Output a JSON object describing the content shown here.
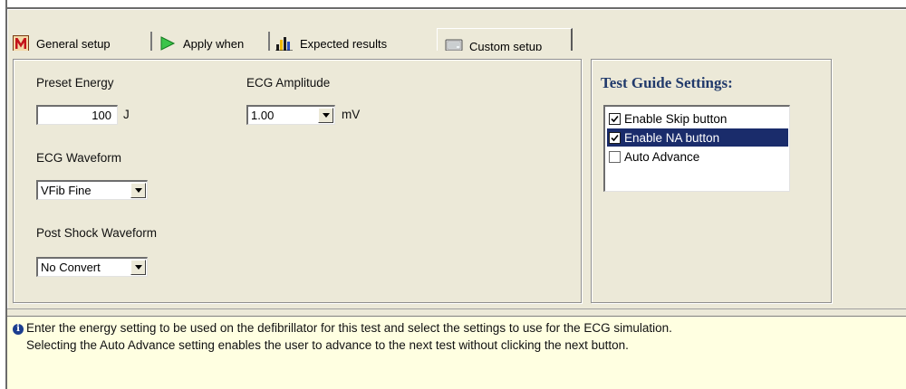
{
  "tabs": [
    {
      "label": "General setup",
      "icon": "m-logo-icon"
    },
    {
      "label": "Apply when",
      "icon": "play-arrow-icon"
    },
    {
      "label": "Expected results",
      "icon": "bar-chart-icon"
    },
    {
      "label": "Custom setup",
      "icon": "monitor-icon",
      "active": true
    }
  ],
  "energy": {
    "label": "Preset Energy",
    "value": "100",
    "unit": "J"
  },
  "ecg_amplitude": {
    "label": "ECG Amplitude",
    "value": "1.00",
    "unit": "mV"
  },
  "ecg_waveform": {
    "label": "ECG Waveform",
    "value": "VFib Fine"
  },
  "post_shock": {
    "label": "Post Shock Waveform",
    "value": "No Convert"
  },
  "test_guide": {
    "title": "Test Guide Settings:",
    "items": [
      {
        "label": "Enable Skip button",
        "checked": true,
        "selected": false
      },
      {
        "label": "Enable NA button",
        "checked": true,
        "selected": true
      },
      {
        "label": "Auto Advance",
        "checked": false,
        "selected": false
      }
    ]
  },
  "info": {
    "icon": "info-icon",
    "line1": "Enter the energy setting to be used on the defibrillator for this test and select the settings to use for the ECG simulation.",
    "line2": "Selecting the Auto Advance setting enables the user to advance to the next test without clicking the next button."
  },
  "colors": {
    "panel": "#ece9d8",
    "info_bg": "#ffffe1",
    "title": "#213a6b",
    "selection": "#1a2c6b",
    "tab_general_icon": "#c4141b",
    "tab_apply_icon": "#1fa32a"
  }
}
